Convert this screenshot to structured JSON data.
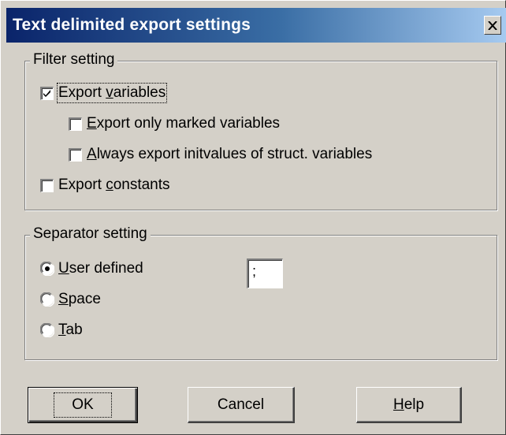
{
  "window": {
    "title": "Text delimited export settings",
    "close_label": "X"
  },
  "filter": {
    "legend": "Filter setting",
    "export_variables": {
      "pre": "Export ",
      "accel": "v",
      "post": "ariables",
      "checked": true
    },
    "export_marked": {
      "pre": "",
      "accel": "E",
      "post": "xport only marked variables",
      "checked": false
    },
    "always_export": {
      "pre": "",
      "accel": "A",
      "post": "lways export initvalues of struct. variables",
      "checked": false
    },
    "export_constants": {
      "pre": "Export ",
      "accel": "c",
      "post": "onstants",
      "checked": false
    }
  },
  "separator": {
    "legend": "Separator setting",
    "user_defined": {
      "pre": "",
      "accel": "U",
      "post": "ser defined",
      "selected": true
    },
    "space": {
      "pre": "",
      "accel": "S",
      "post": "pace",
      "selected": false
    },
    "tab": {
      "pre": "",
      "accel": "T",
      "post": "ab",
      "selected": false
    },
    "input_value": ";"
  },
  "buttons": {
    "ok": "OK",
    "cancel": "Cancel",
    "help_accel": "H",
    "help_rest": "elp"
  },
  "colors": {
    "face": "#d4d0c8",
    "title_start": "#0a246a",
    "title_end": "#a6caf0"
  }
}
